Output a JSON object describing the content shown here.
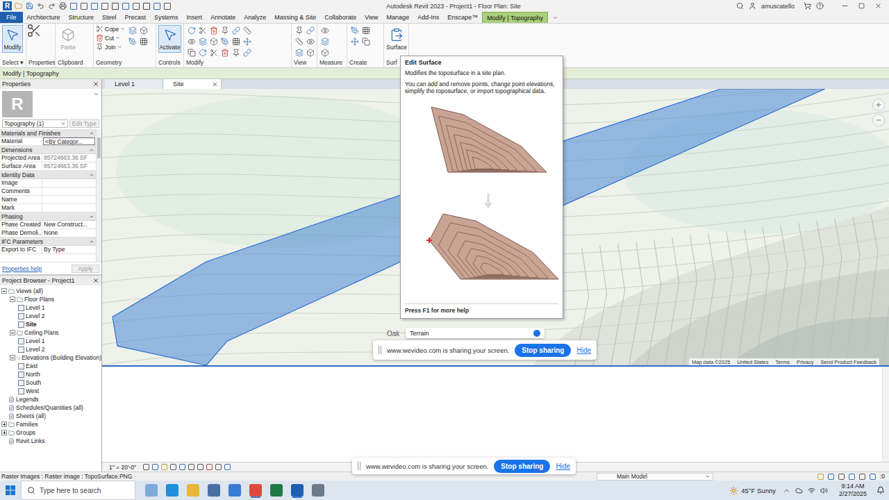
{
  "window": {
    "title": "Autodesk Revit 2023 - Project1 - Floor Plan: Site",
    "user": "amuscatello",
    "app_letter": "R"
  },
  "ribbon_tabs": [
    {
      "label": "File",
      "kind": "file",
      "selected": false
    },
    {
      "label": "Architecture",
      "kind": "tab",
      "selected": false
    },
    {
      "label": "Structure",
      "kind": "tab",
      "selected": false
    },
    {
      "label": "Steel",
      "kind": "tab",
      "selected": false
    },
    {
      "label": "Precast",
      "kind": "tab",
      "selected": false
    },
    {
      "label": "Systems",
      "kind": "tab",
      "selected": false
    },
    {
      "label": "Insert",
      "kind": "tab",
      "selected": false
    },
    {
      "label": "Annotate",
      "kind": "tab",
      "selected": false
    },
    {
      "label": "Analyze",
      "kind": "tab",
      "selected": false
    },
    {
      "label": "Massing & Site",
      "kind": "tab",
      "selected": false
    },
    {
      "label": "Collaborate",
      "kind": "tab",
      "selected": false
    },
    {
      "label": "View",
      "kind": "tab",
      "selected": false
    },
    {
      "label": "Manage",
      "kind": "tab",
      "selected": false
    },
    {
      "label": "Add-Ins",
      "kind": "tab",
      "selected": false
    },
    {
      "label": "Enscape™",
      "kind": "tab",
      "selected": false
    },
    {
      "label": "Modify | Topography",
      "kind": "tab",
      "selected": true
    }
  ],
  "ribbon_groups": [
    {
      "label": "Select ▾",
      "tools": [
        {
          "label": "Modify",
          "kind": "large",
          "selected": true,
          "disabled": false
        }
      ]
    },
    {
      "label": "Properties",
      "tools": []
    },
    {
      "label": "Clipboard",
      "tools": [
        {
          "label": "Paste",
          "kind": "large",
          "selected": false,
          "disabled": true
        }
      ]
    },
    {
      "label": "Geometry",
      "tools": [
        {
          "label": "Cope",
          "kind": "small",
          "selected": false,
          "disabled": false
        },
        {
          "label": "Cut",
          "kind": "small",
          "selected": false,
          "disabled": false
        },
        {
          "label": "Join",
          "kind": "small",
          "selected": false,
          "disabled": false
        }
      ]
    },
    {
      "label": "Controls",
      "tools": [
        {
          "label": "Activate",
          "kind": "large",
          "selected": true,
          "disabled": false
        }
      ]
    },
    {
      "label": "Modify",
      "tools": []
    },
    {
      "label": "View",
      "tools": []
    },
    {
      "label": "Measure",
      "tools": []
    },
    {
      "label": "Create",
      "tools": []
    },
    {
      "label": "Surf",
      "tools": [
        {
          "label": "Surface",
          "kind": "large",
          "selected": false,
          "disabled": false
        }
      ]
    }
  ],
  "options_bar": {
    "label": "Modify | Topography"
  },
  "properties": {
    "title": "Properties",
    "type_icon": "R",
    "type": "Topography (1)",
    "edit_type": {
      "label": "Edit Type",
      "disabled": true
    },
    "sections": [
      {
        "label": "Materials and Finishes",
        "rows": [
          {
            "name": "Material",
            "value": "<By Categor...",
            "kind": "field"
          }
        ]
      },
      {
        "label": "Dimensions",
        "rows": [
          {
            "name": "Projected Area",
            "value": "85724663.36 SF",
            "kind": "readonly"
          },
          {
            "name": "Surface Area",
            "value": "85724663.36 SF",
            "kind": "readonly"
          }
        ]
      },
      {
        "label": "Identity Data",
        "rows": [
          {
            "name": "Image",
            "value": "",
            "kind": "text"
          },
          {
            "name": "Comments",
            "value": "",
            "kind": "text"
          },
          {
            "name": "Name",
            "value": "",
            "kind": "text"
          },
          {
            "name": "Mark",
            "value": "",
            "kind": "text"
          }
        ]
      },
      {
        "label": "Phasing",
        "rows": [
          {
            "name": "Phase Created",
            "value": "New Construct...",
            "kind": "text"
          },
          {
            "name": "Phase Demoli...",
            "value": "None",
            "kind": "text"
          }
        ]
      },
      {
        "label": "IFC Parameters",
        "rows": [
          {
            "name": "Export to IFC",
            "value": "By Type",
            "kind": "text"
          }
        ]
      }
    ],
    "help": "Properties help",
    "apply": {
      "label": "Apply",
      "disabled": true
    }
  },
  "project_browser": {
    "title": "Project Browser - Project1",
    "items": [
      {
        "label": "Views (all)",
        "depth": 0,
        "kind": "group",
        "expanded": true,
        "selected": false
      },
      {
        "label": "Floor Plans",
        "depth": 1,
        "kind": "group",
        "expanded": true,
        "selected": false
      },
      {
        "label": "Level 1",
        "depth": 2,
        "kind": "leaf",
        "expanded": false,
        "selected": false
      },
      {
        "label": "Level 2",
        "depth": 2,
        "kind": "leaf",
        "expanded": false,
        "selected": false
      },
      {
        "label": "Site",
        "depth": 2,
        "kind": "leaf",
        "expanded": false,
        "selected": true
      },
      {
        "label": "Ceiling Plans",
        "depth": 1,
        "kind": "group",
        "expanded": true,
        "selected": false
      },
      {
        "label": "Level 1",
        "depth": 2,
        "kind": "leaf",
        "expanded": false,
        "selected": false
      },
      {
        "label": "Level 2",
        "depth": 2,
        "kind": "leaf",
        "expanded": false,
        "selected": false
      },
      {
        "label": "Elevations (Building Elevation)",
        "depth": 1,
        "kind": "group",
        "expanded": true,
        "selected": false
      },
      {
        "label": "East",
        "depth": 2,
        "kind": "leaf",
        "expanded": false,
        "selected": false
      },
      {
        "label": "North",
        "depth": 2,
        "kind": "leaf",
        "expanded": false,
        "selected": false
      },
      {
        "label": "South",
        "depth": 2,
        "kind": "leaf",
        "expanded": false,
        "selected": false
      },
      {
        "label": "West",
        "depth": 2,
        "kind": "leaf",
        "expanded": false,
        "selected": false
      },
      {
        "label": "Legends",
        "depth": 0,
        "kind": "leaf",
        "expanded": false,
        "selected": false
      },
      {
        "label": "Schedules/Quantities (all)",
        "depth": 0,
        "kind": "leaf",
        "expanded": false,
        "selected": false
      },
      {
        "label": "Sheets (all)",
        "depth": 0,
        "kind": "leaf",
        "expanded": false,
        "selected": false
      },
      {
        "label": "Families",
        "depth": 0,
        "kind": "group",
        "expanded": false,
        "selected": false
      },
      {
        "label": "Groups",
        "depth": 0,
        "kind": "group",
        "expanded": false,
        "selected": false
      },
      {
        "label": "Revit Links",
        "depth": 0,
        "kind": "leaf",
        "expanded": false,
        "selected": false
      }
    ]
  },
  "view_tabs": [
    {
      "label": "Level 1",
      "selected": false
    },
    {
      "label": "Site",
      "selected": true
    }
  ],
  "map": {
    "place_label": "Oak",
    "layer_button": "Terrain",
    "attribution": [
      "Map data ©2025",
      "United States",
      "Terms",
      "Privacy",
      "Send Product Feedback"
    ]
  },
  "view_control": {
    "scale": "1\" = 20'-0\""
  },
  "tooltip": {
    "title": "Edit Surface",
    "summary": "Modifies the toposurface in a site plan.",
    "detail": "You can add and remove points, change point elevations, simplify the toposurface, or import topographical data.",
    "help": "Press F1 for more help"
  },
  "share_bars": [
    {
      "text": "www.wevideo.com is sharing your screen.",
      "stop": "Stop sharing",
      "hide": "Hide"
    },
    {
      "text": "www.wevideo.com is sharing your screen.",
      "stop": "Stop sharing",
      "hide": "Hide"
    }
  ],
  "status_bar": {
    "text": "Raster Images : Raster image : TopoSurface.PNG",
    "workset": "Main Model",
    "filter": ":0"
  },
  "taskbar": {
    "search_placeholder": "Type here to search",
    "weather": "45°F Sunny",
    "time": "9:14 AM",
    "date": "2/27/2025"
  }
}
